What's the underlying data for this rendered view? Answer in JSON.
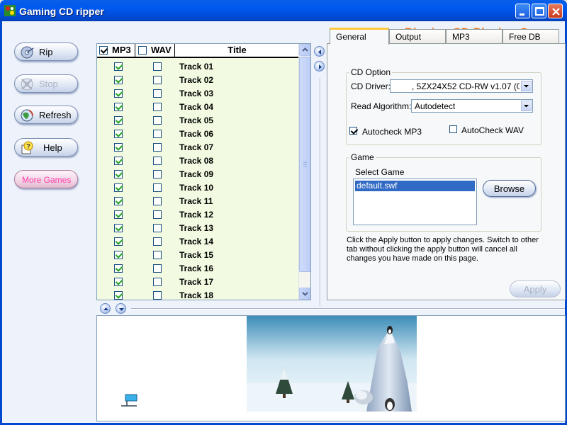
{
  "window": {
    "title": "Gaming CD ripper"
  },
  "header": {
    "slogan": "Ripping CD  Playing Game"
  },
  "left_buttons": [
    {
      "label": "Rip",
      "icon": "disc-rip-icon",
      "enabled": true
    },
    {
      "label": "Stop",
      "icon": "disc-stop-icon",
      "enabled": false
    },
    {
      "label": "Refresh",
      "icon": "refresh-globe-icon",
      "enabled": true
    },
    {
      "label": "Help",
      "icon": "help-question-icon",
      "enabled": true
    },
    {
      "label": "More Games",
      "icon": "",
      "enabled": true
    }
  ],
  "tracklist": {
    "columns": {
      "mp3": "MP3",
      "wav": "WAV",
      "title": "Title"
    },
    "header_mp3_checked": true,
    "header_wav_checked": false,
    "tracks": [
      {
        "title": "Track 01",
        "mp3": true,
        "wav": false
      },
      {
        "title": "Track 02",
        "mp3": true,
        "wav": false
      },
      {
        "title": "Track 03",
        "mp3": true,
        "wav": false
      },
      {
        "title": "Track 04",
        "mp3": true,
        "wav": false
      },
      {
        "title": "Track 05",
        "mp3": true,
        "wav": false
      },
      {
        "title": "Track 06",
        "mp3": true,
        "wav": false
      },
      {
        "title": "Track 07",
        "mp3": true,
        "wav": false
      },
      {
        "title": "Track 08",
        "mp3": true,
        "wav": false
      },
      {
        "title": "Track 09",
        "mp3": true,
        "wav": false
      },
      {
        "title": "Track 10",
        "mp3": true,
        "wav": false
      },
      {
        "title": "Track 11",
        "mp3": true,
        "wav": false
      },
      {
        "title": "Track 12",
        "mp3": true,
        "wav": false
      },
      {
        "title": "Track 13",
        "mp3": true,
        "wav": false
      },
      {
        "title": "Track 14",
        "mp3": true,
        "wav": false
      },
      {
        "title": "Track 15",
        "mp3": true,
        "wav": false
      },
      {
        "title": "Track 16",
        "mp3": true,
        "wav": false
      },
      {
        "title": "Track 17",
        "mp3": true,
        "wav": false
      },
      {
        "title": "Track 18",
        "mp3": true,
        "wav": false
      }
    ]
  },
  "tabs": [
    {
      "label": "General",
      "active": true
    },
    {
      "label": "Output",
      "active": false
    },
    {
      "label": "MP3",
      "active": false
    },
    {
      "label": "Free DB",
      "active": false
    }
  ],
  "cd_option": {
    "legend": "CD Option",
    "driver_label": "CD Driver:",
    "driver_value": ", 5ZX24X52 CD-RW   v1.07 (0:1:",
    "algorithm_label": "Read Algorithm:",
    "algorithm_value": "Autodetect",
    "autocheck_mp3_label": "Autocheck MP3",
    "autocheck_mp3_checked": true,
    "autocheck_wav_label": "AutoCheck WAV",
    "autocheck_wav_checked": false
  },
  "game": {
    "legend": "Game",
    "select_label": "Select Game",
    "selected": "default.swf",
    "browse_label": "Browse"
  },
  "note": "Click the Apply button to apply changes. Switch to other tab without clicking the apply button will cancel all changes you have made on this page.",
  "apply_label": "Apply",
  "colors": {
    "accent_orange": "#f27a1e",
    "more_games_pink": "#ff3da8",
    "list_bg": "#f2fae1",
    "titlebar_blue": "#0058ee",
    "selection_blue": "#316ac5"
  }
}
